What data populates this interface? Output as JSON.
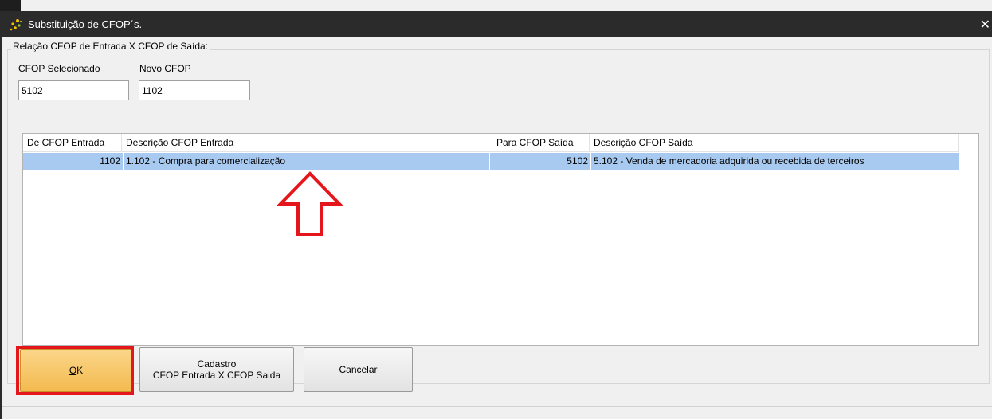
{
  "window": {
    "title": "Substituição de CFOP´s.",
    "close_symbol": "✕"
  },
  "group": {
    "legend": "Relação CFOP de Entrada X CFOP de Saída:"
  },
  "fields": {
    "cfop_selecionado_label": "CFOP Selecionado",
    "cfop_selecionado_value": "5102",
    "novo_cfop_label": "Novo CFOP",
    "novo_cfop_value": "1102"
  },
  "grid": {
    "columns": [
      "De CFOP Entrada",
      "Descrição CFOP Entrada",
      "Para CFOP Saída",
      "Descrição CFOP Saída"
    ],
    "rows": [
      {
        "de_cfop_entrada": "1102",
        "descricao_entrada": "1.102 - Compra para comercialização",
        "para_cfop_saida": "5102",
        "descricao_saida": "5.102 - Venda de mercadoria adquirida ou recebida de terceiros",
        "selected": true
      }
    ]
  },
  "buttons": {
    "ok_mnemonic": "O",
    "ok_rest": "K",
    "cadastro_line1": "Cadastro",
    "cadastro_line2": "CFOP Entrada X CFOP Saida",
    "cancelar_mnemonic": "C",
    "cancelar_rest": "ancelar"
  },
  "icons": {
    "app": "sparkle-icon",
    "close": "close-icon",
    "annotation": "arrow-up-annotation-icon"
  },
  "colors": {
    "titlebar": "#2b2b2b",
    "selected_row": "#a8caf0",
    "ok_button": "#f3ba4f",
    "highlight": "#e4161b"
  }
}
